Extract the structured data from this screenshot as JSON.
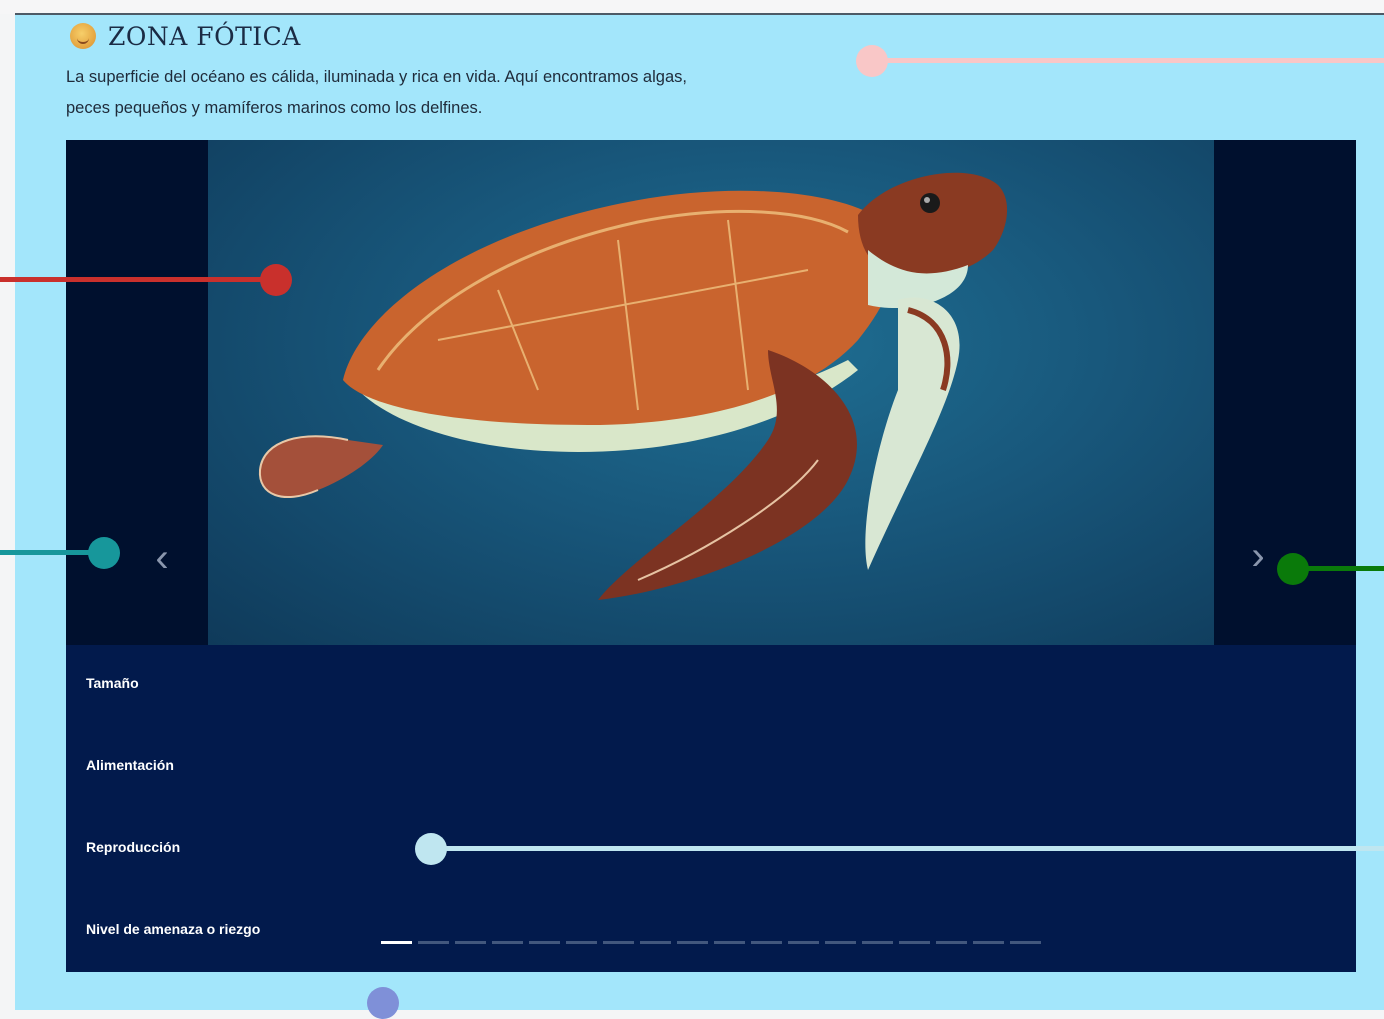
{
  "header": {
    "title": "ZONA FÓTICA",
    "icon": "smiley-sun-icon"
  },
  "description": {
    "line1": "La superficie del océano es cálida, iluminada y rica en vida. Aquí encontramos algas,",
    "line2": "peces pequeños y mamíferos marinos como los delfines."
  },
  "carousel": {
    "image_subject": "sea-turtle",
    "prev_icon": "chevron-left-icon",
    "next_icon": "chevron-right-icon",
    "prev_glyph": "‹",
    "next_glyph": "›",
    "slide_count": 18,
    "active_slide": 1
  },
  "accordion": {
    "items": [
      {
        "label": "Tamaño"
      },
      {
        "label": "Alimentación"
      },
      {
        "label": "Reproducción"
      },
      {
        "label": "Nivel de amenaza o riezgo"
      }
    ]
  },
  "colors": {
    "panel_bg": "#a3e6fb",
    "viewer_bg": "#021a4c",
    "annotation_pink": "#f9c7c7",
    "annotation_red": "#c9302c",
    "annotation_teal": "#17979b",
    "annotation_green": "#0a7a0a",
    "annotation_lightblue": "#bfe6f0",
    "annotation_periwinkle": "#7f90d8"
  }
}
